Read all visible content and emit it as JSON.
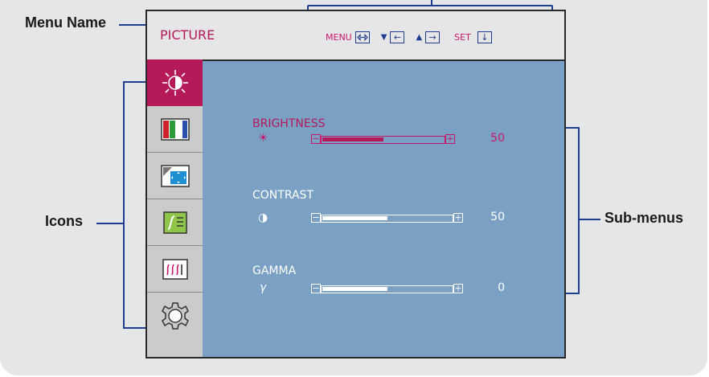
{
  "callouts": {
    "menu_name": "Menu Name",
    "icons": "Icons",
    "sub_menus": "Sub-menus"
  },
  "osd": {
    "menu_name": "PICTURE",
    "controls": [
      {
        "label": "MENU",
        "key_icon": "exit-arrows-icon"
      },
      {
        "label": "▼",
        "key_icon": "left-arrow-icon"
      },
      {
        "label": "▲",
        "key_icon": "right-arrow-icon"
      },
      {
        "label": "SET",
        "key_icon": "down-arrow-icon"
      }
    ],
    "sidebar": [
      {
        "icon": "brightness-icon",
        "active": true
      },
      {
        "icon": "color-bars-icon",
        "active": false
      },
      {
        "icon": "screen-position-icon",
        "active": false
      },
      {
        "icon": "tracking-icon",
        "active": false
      },
      {
        "icon": "wave-icon",
        "active": false
      },
      {
        "icon": "setup-gear-icon",
        "active": false
      }
    ],
    "submenus": [
      {
        "label": "BRIGHTNESS",
        "symbol": "☀",
        "value": "50",
        "level": 50,
        "active": true
      },
      {
        "label": "CONTRAST",
        "symbol": "◑",
        "value": "50",
        "level": 50,
        "active": false
      },
      {
        "label": "GAMMA",
        "symbol": "γ",
        "value": "0",
        "level": 50,
        "active": false
      }
    ],
    "accent_color": "#b5195a",
    "panel_color": "#7aa0c3",
    "callout_line_color": "#1f3d8f"
  }
}
